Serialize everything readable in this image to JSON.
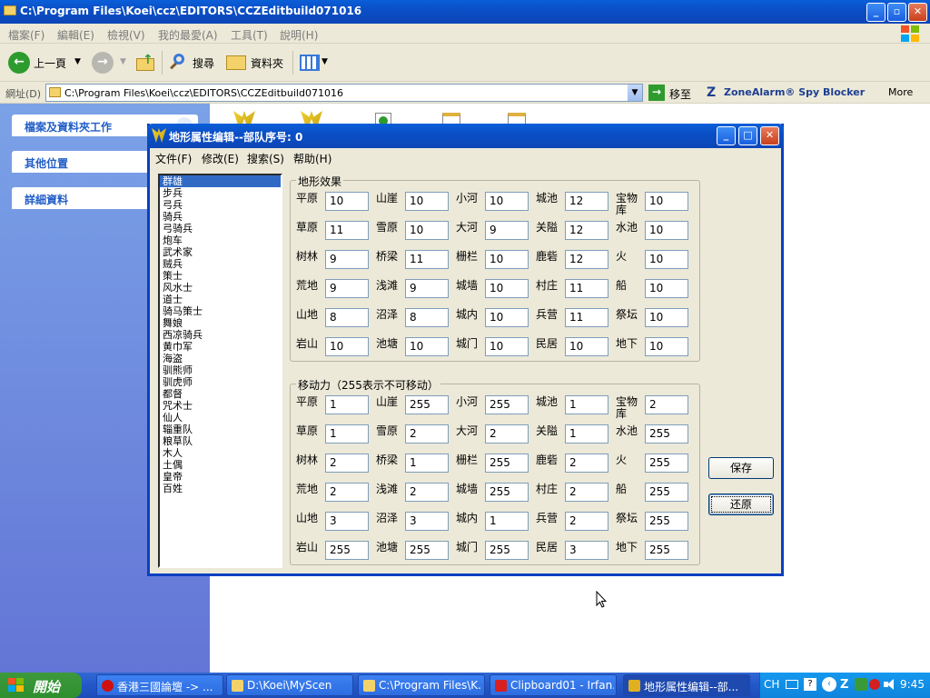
{
  "explorer": {
    "title": "C:\\Program Files\\Koei\\ccz\\EDITORS\\CCZEditbuild071016",
    "menu": [
      "檔案(F)",
      "編輯(E)",
      "檢視(V)",
      "我的最愛(A)",
      "工具(T)",
      "說明(H)"
    ],
    "toolbar": {
      "back": "上一頁",
      "search": "搜尋",
      "folders": "資料夾"
    },
    "address_label": "網址(D)",
    "address_value": "C:\\Program Files\\Koei\\ccz\\EDITORS\\CCZEditbuild071016",
    "go": "移至",
    "zonealarm": "ZoneAlarm® Spy Blocker",
    "more": "More",
    "side_panels": [
      "檔案及資料夾工作",
      "其他位置",
      "詳細資料"
    ]
  },
  "dialog": {
    "title": "地形属性编辑--部队序号: 0",
    "menu": [
      "文件(F)",
      "修改(E)",
      "搜索(S)",
      "帮助(H)"
    ],
    "units": [
      "群雄",
      "步兵",
      "弓兵",
      "骑兵",
      "弓骑兵",
      "炮车",
      "武术家",
      "贼兵",
      "策士",
      "风水士",
      "道士",
      "骑马策士",
      "舞娘",
      "西凉骑兵",
      "黄巾军",
      "海盗",
      "驯熊师",
      "驯虎师",
      "都督",
      "咒术士",
      "仙人",
      "辎重队",
      "粮草队",
      "木人",
      "土偶",
      "皇帝",
      "百姓"
    ],
    "selected_unit": 0,
    "terrain_title": "地形效果",
    "move_title": "移动力（255表示不可移动）",
    "terrain_labels": [
      [
        "平原",
        "山崖",
        "小河",
        "城池",
        "宝物库"
      ],
      [
        "草原",
        "雪原",
        "大河",
        "关隘",
        "水池"
      ],
      [
        "树林",
        "桥梁",
        "栅栏",
        "鹿砦",
        "火"
      ],
      [
        "荒地",
        "浅滩",
        "城墙",
        "村庄",
        "船"
      ],
      [
        "山地",
        "沼泽",
        "城内",
        "兵营",
        "祭坛"
      ],
      [
        "岩山",
        "池塘",
        "城门",
        "民居",
        "地下"
      ]
    ],
    "terrain_values": [
      [
        "10",
        "10",
        "10",
        "12",
        "10"
      ],
      [
        "11",
        "10",
        "9",
        "12",
        "10"
      ],
      [
        "9",
        "11",
        "10",
        "12",
        "10"
      ],
      [
        "9",
        "9",
        "10",
        "11",
        "10"
      ],
      [
        "8",
        "8",
        "10",
        "11",
        "10"
      ],
      [
        "10",
        "10",
        "10",
        "10",
        "10"
      ]
    ],
    "move_values": [
      [
        "1",
        "255",
        "255",
        "1",
        "2"
      ],
      [
        "1",
        "2",
        "2",
        "1",
        "255"
      ],
      [
        "2",
        "1",
        "255",
        "2",
        "255"
      ],
      [
        "2",
        "2",
        "255",
        "2",
        "255"
      ],
      [
        "3",
        "3",
        "1",
        "2",
        "255"
      ],
      [
        "255",
        "255",
        "255",
        "3",
        "255"
      ]
    ],
    "save": "保存",
    "restore": "还原"
  },
  "taskbar": {
    "start": "開始",
    "tasks": [
      "香港三國論壇 -> ...",
      "D:\\Koei\\MyScen",
      "C:\\Program Files\\K...",
      "Clipboard01 - Irfan...",
      "地形属性编辑--部..."
    ],
    "lang": "CH",
    "clock": "9:45"
  },
  "colors": {
    "xp_blue": "#0a4fc7",
    "dialog_bg": "#ece9d8",
    "selection": "#316ac5",
    "start_green": "#2f8f2f"
  }
}
